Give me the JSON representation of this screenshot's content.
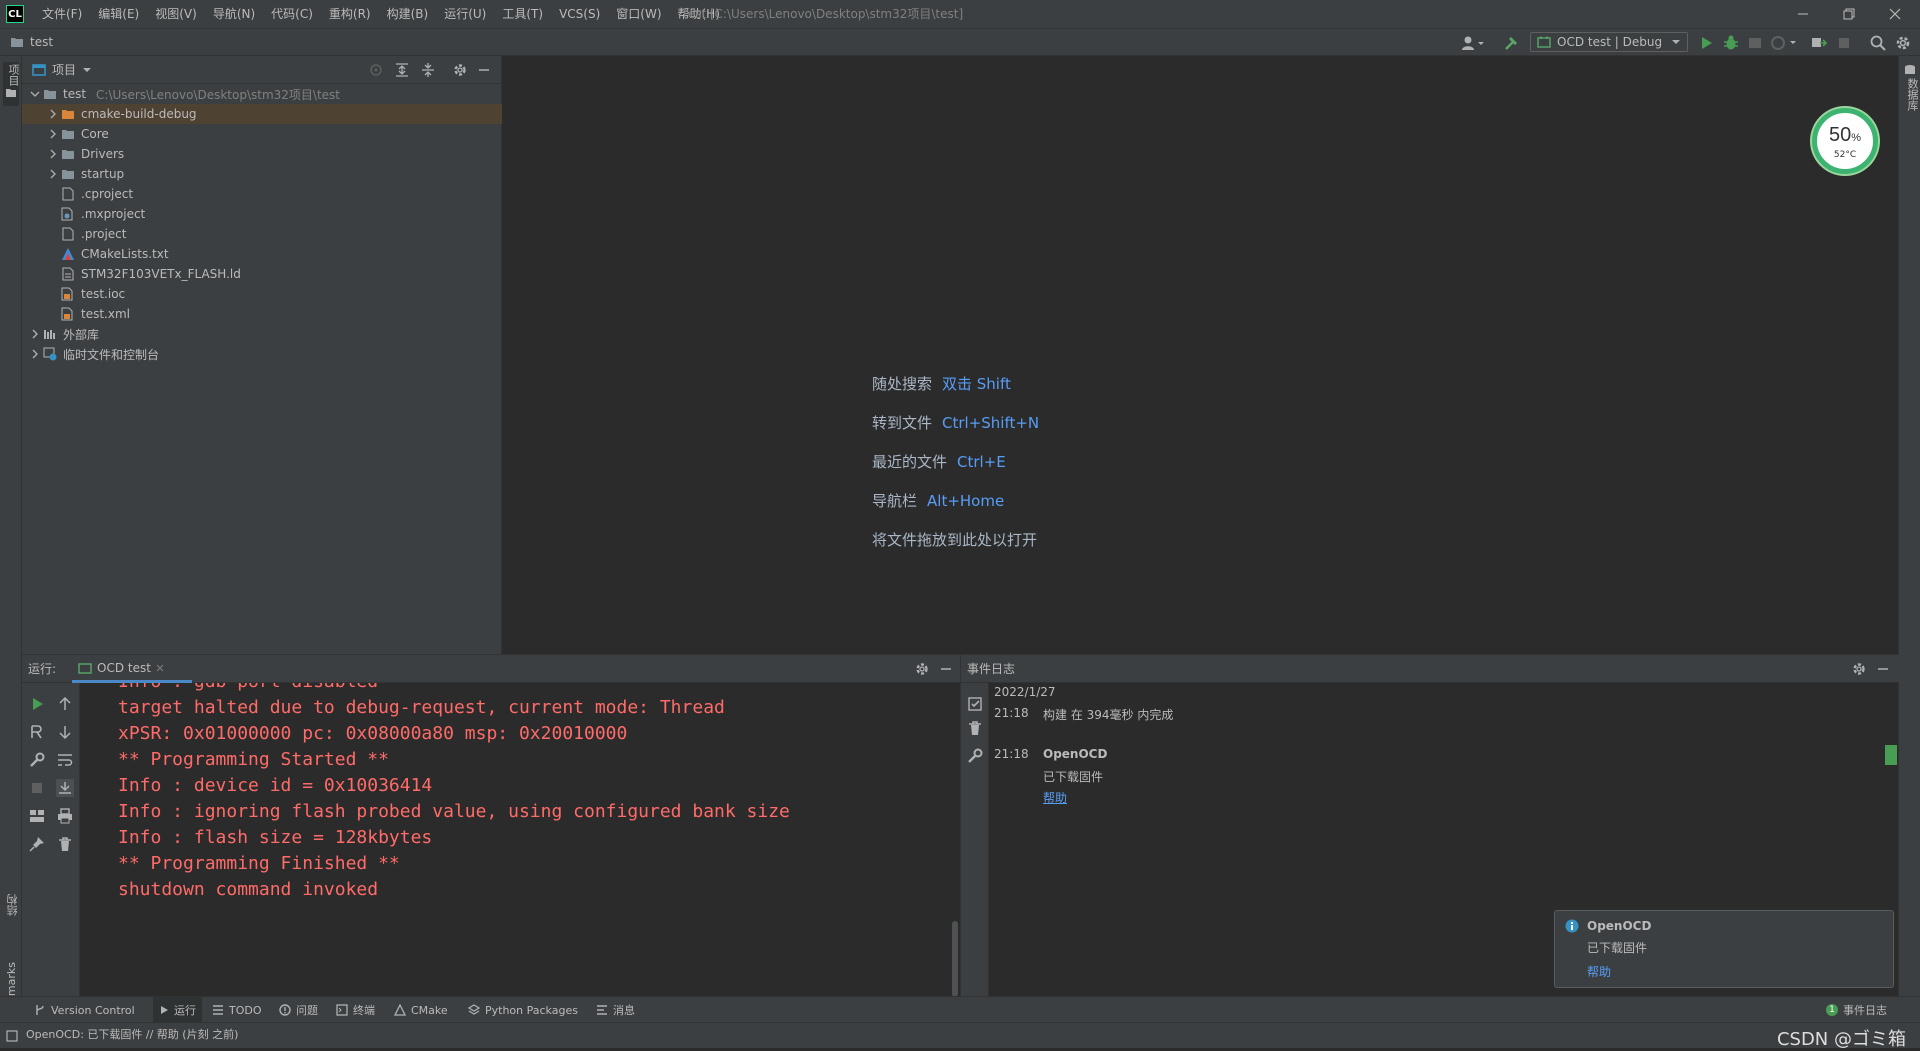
{
  "app": {
    "logo": "CL",
    "window_title": "test [C:\\Users\\Lenovo\\Desktop\\stm32项目\\test]"
  },
  "menu": [
    "文件(F)",
    "编辑(E)",
    "视图(V)",
    "导航(N)",
    "代码(C)",
    "重构(R)",
    "构建(B)",
    "运行(U)",
    "工具(T)",
    "VCS(S)",
    "窗口(W)",
    "帮助(H)"
  ],
  "navbar": {
    "breadcrumb": "test",
    "run_config": "OCD test | Debug"
  },
  "left_stripe": {
    "project": "项目",
    "structure": "结构",
    "bookmarks": "Bookmarks"
  },
  "right_stripe": {
    "database": "数据库"
  },
  "project": {
    "title": "项目",
    "root": {
      "name": "test",
      "path": "C:\\Users\\Lenovo\\Desktop\\stm32项目\\test"
    },
    "items": [
      {
        "name": "cmake-build-debug",
        "type": "folder-orange",
        "expandable": true,
        "selected": true
      },
      {
        "name": "Core",
        "type": "folder",
        "expandable": true
      },
      {
        "name": "Drivers",
        "type": "folder",
        "expandable": true
      },
      {
        "name": "startup",
        "type": "folder",
        "expandable": true
      },
      {
        "name": ".cproject",
        "type": "file",
        "expandable": false
      },
      {
        "name": ".mxproject",
        "type": "file-cog",
        "expandable": false
      },
      {
        "name": ".project",
        "type": "file",
        "expandable": false
      },
      {
        "name": "CMakeLists.txt",
        "type": "cmake",
        "expandable": false
      },
      {
        "name": "STM32F103VETx_FLASH.ld",
        "type": "file",
        "expandable": false
      },
      {
        "name": "test.ioc",
        "type": "file-cube",
        "expandable": false
      },
      {
        "name": "test.xml",
        "type": "file-xml",
        "expandable": false
      }
    ],
    "external_libs": "外部库",
    "scratches": "临时文件和控制台"
  },
  "editor": {
    "hints": [
      {
        "label": "随处搜索",
        "key": "双击 Shift"
      },
      {
        "label": "转到文件",
        "key": "Ctrl+Shift+N"
      },
      {
        "label": "最近的文件",
        "key": "Ctrl+E"
      },
      {
        "label": "导航栏",
        "key": "Alt+Home"
      },
      {
        "label": "将文件拖放到此处以打开",
        "key": ""
      }
    ]
  },
  "cpu_widget": {
    "percent": "50",
    "percent_sign": "%",
    "temperature": "52°C"
  },
  "run_panel": {
    "label": "运行:",
    "tab": "OCD test",
    "console_lines": [
      "Info : gdb port disabled",
      "target halted due to debug-request, current mode: Thread",
      "xPSR: 0x01000000 pc: 0x08000a80 msp: 0x20010000",
      "** Programming Started **",
      "Info : device id = 0x10036414",
      "Info : ignoring flash probed value, using configured bank size",
      "Info : flash size = 128kbytes",
      "** Programming Finished **",
      "shutdown command invoked"
    ]
  },
  "event_log": {
    "title": "事件日志",
    "date": "2022/1/27",
    "entries": [
      {
        "time": "21:18",
        "message": "构建 在 394毫秒 内完成"
      },
      {
        "time": "21:18",
        "title": "OpenOCD",
        "message": "已下载固件",
        "link": "帮助"
      }
    ]
  },
  "notification": {
    "title": "OpenOCD",
    "message": "已下载固件",
    "link": "帮助"
  },
  "bottom_tabs": [
    "Version Control",
    "运行",
    "TODO",
    "问题",
    "终端",
    "CMake",
    "Python Packages",
    "消息"
  ],
  "bottom_right": {
    "event_log_count": "1",
    "event_log_label": "事件日志"
  },
  "status_bar": {
    "message": "OpenOCD: 已下载固件 // 帮助 (片刻 之前)",
    "watermark": "CSDN @ゴミ箱"
  },
  "colors": {
    "background": "#2b2b2b",
    "panel": "#3c3f41",
    "console_error": "#ff6b68",
    "link": "#589df6",
    "selection": "#4e4232"
  }
}
